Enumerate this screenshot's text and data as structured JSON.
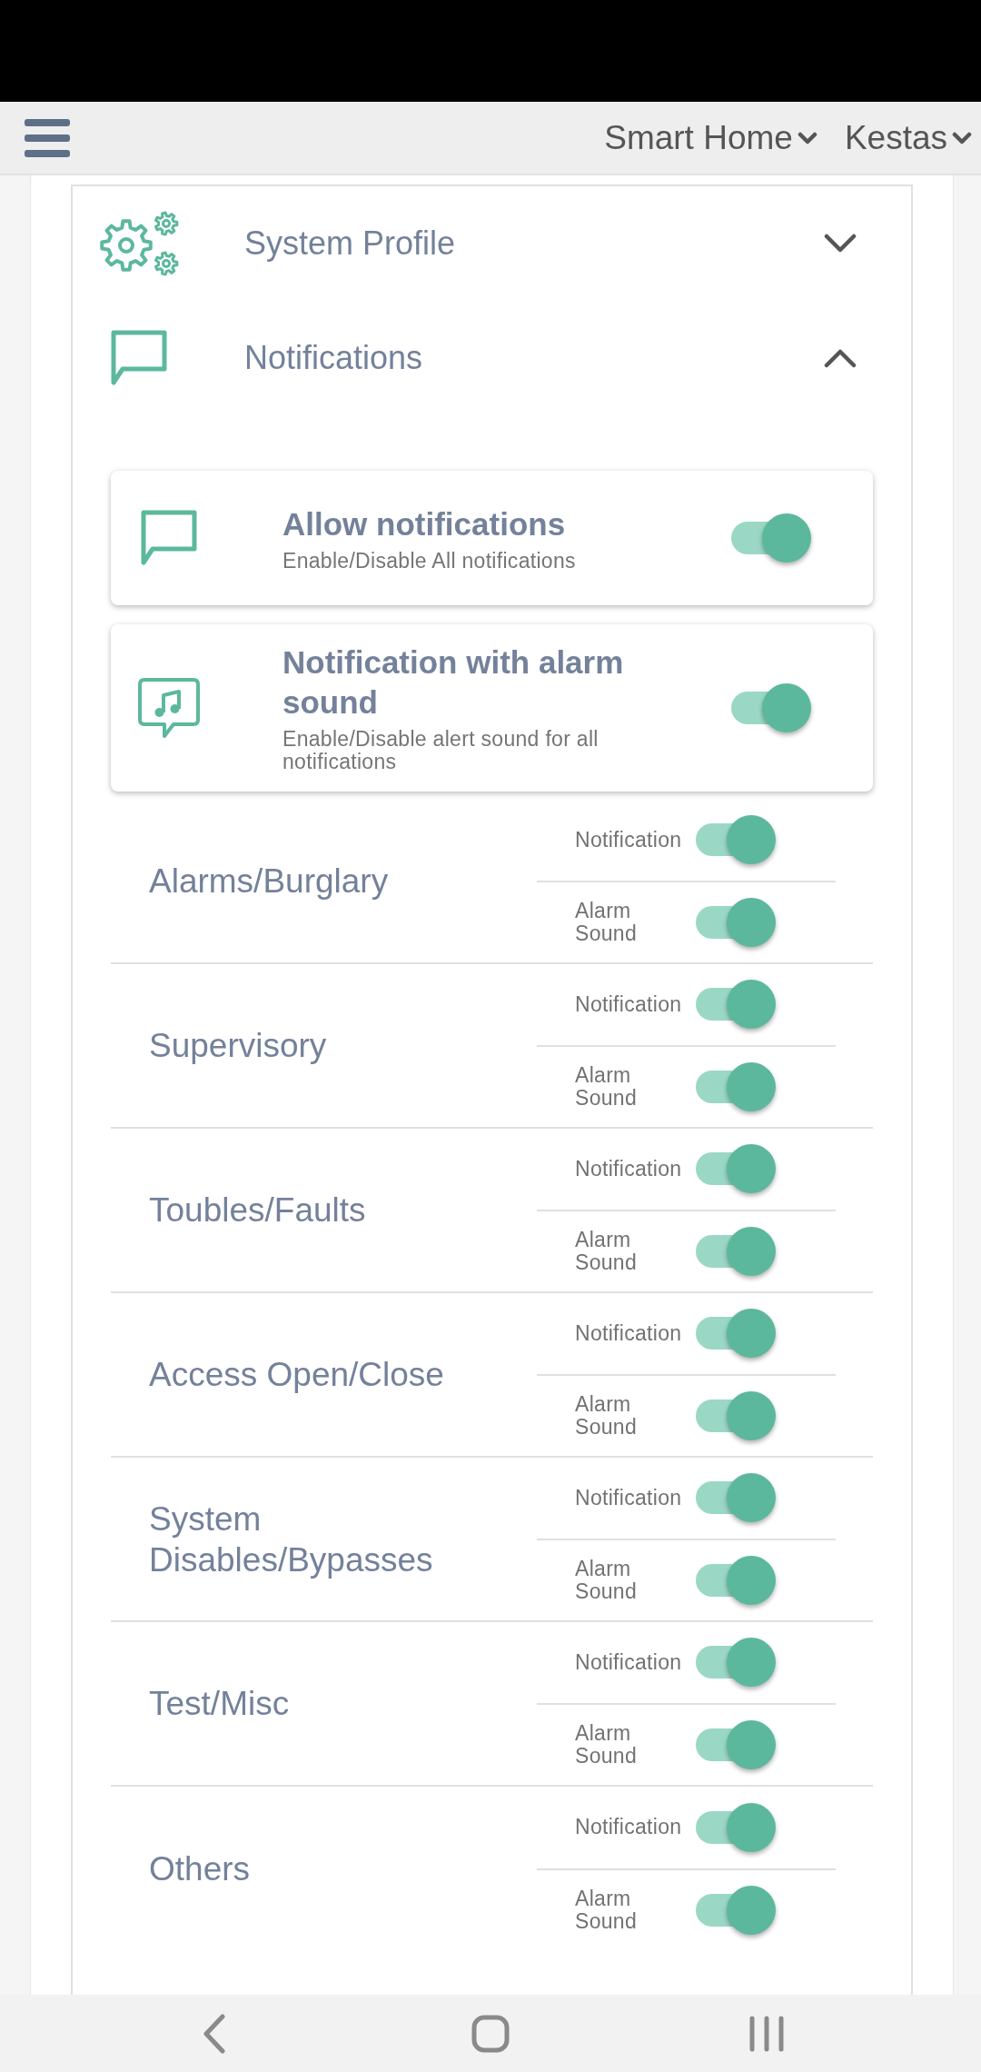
{
  "app_bar": {
    "home_selector": "Smart Home",
    "user_selector": "Kestas"
  },
  "sections": [
    {
      "title": "System Profile",
      "expanded": false
    },
    {
      "title": "Notifications",
      "expanded": true
    }
  ],
  "settings": [
    {
      "title": "Allow notifications",
      "subtitle": "Enable/Disable All notifications",
      "on": true
    },
    {
      "title": "Notification with alarm sound",
      "subtitle": "Enable/Disable alert sound for all notifications",
      "on": true
    }
  ],
  "categories": [
    {
      "name": "Alarms/Burglary",
      "toggles": [
        {
          "label": "Notification",
          "on": true
        },
        {
          "label": "Alarm Sound",
          "on": true
        }
      ]
    },
    {
      "name": "Supervisory",
      "toggles": [
        {
          "label": "Notification",
          "on": true
        },
        {
          "label": "Alarm Sound",
          "on": true
        }
      ]
    },
    {
      "name": "Toubles/Faults",
      "toggles": [
        {
          "label": "Notification",
          "on": true
        },
        {
          "label": "Alarm Sound",
          "on": true
        }
      ]
    },
    {
      "name": "Access Open/Close",
      "toggles": [
        {
          "label": "Notification",
          "on": true
        },
        {
          "label": "Alarm Sound",
          "on": true
        }
      ]
    },
    {
      "name": "System Disables/Bypasses",
      "toggles": [
        {
          "label": "Notification",
          "on": true
        },
        {
          "label": "Alarm Sound",
          "on": true
        }
      ]
    },
    {
      "name": "Test/Misc",
      "toggles": [
        {
          "label": "Notification",
          "on": true
        },
        {
          "label": "Alarm Sound",
          "on": true
        }
      ]
    },
    {
      "name": "Others",
      "toggles": [
        {
          "label": "Notification",
          "on": true
        },
        {
          "label": "Alarm Sound",
          "on": true
        }
      ]
    }
  ]
}
